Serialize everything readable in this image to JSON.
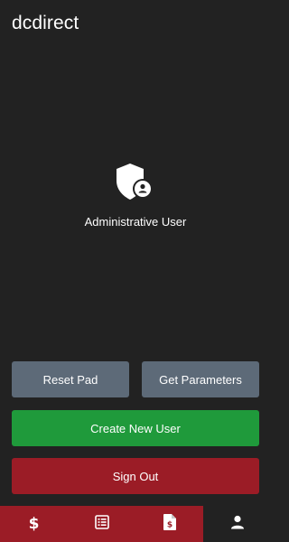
{
  "app": {
    "title": "dcdirect"
  },
  "profile": {
    "icon": "admin-shield-user-icon",
    "role_label": "Administrative User"
  },
  "actions": {
    "reset_pad_label": "Reset Pad",
    "get_parameters_label": "Get Parameters",
    "create_new_user_label": "Create New User",
    "sign_out_label": "Sign Out"
  },
  "bottom_nav": {
    "items": [
      {
        "icon": "dollar-icon",
        "active": false,
        "glyph": "$"
      },
      {
        "icon": "list-icon",
        "active": false
      },
      {
        "icon": "invoice-icon",
        "active": false
      },
      {
        "icon": "user-icon",
        "active": true
      }
    ]
  },
  "colors": {
    "background": "#222222",
    "button_gray": "#5d6a78",
    "button_green": "#1f9a3b",
    "button_red": "#9b1c26",
    "nav_red": "#9b1c26",
    "text": "#ffffff"
  }
}
